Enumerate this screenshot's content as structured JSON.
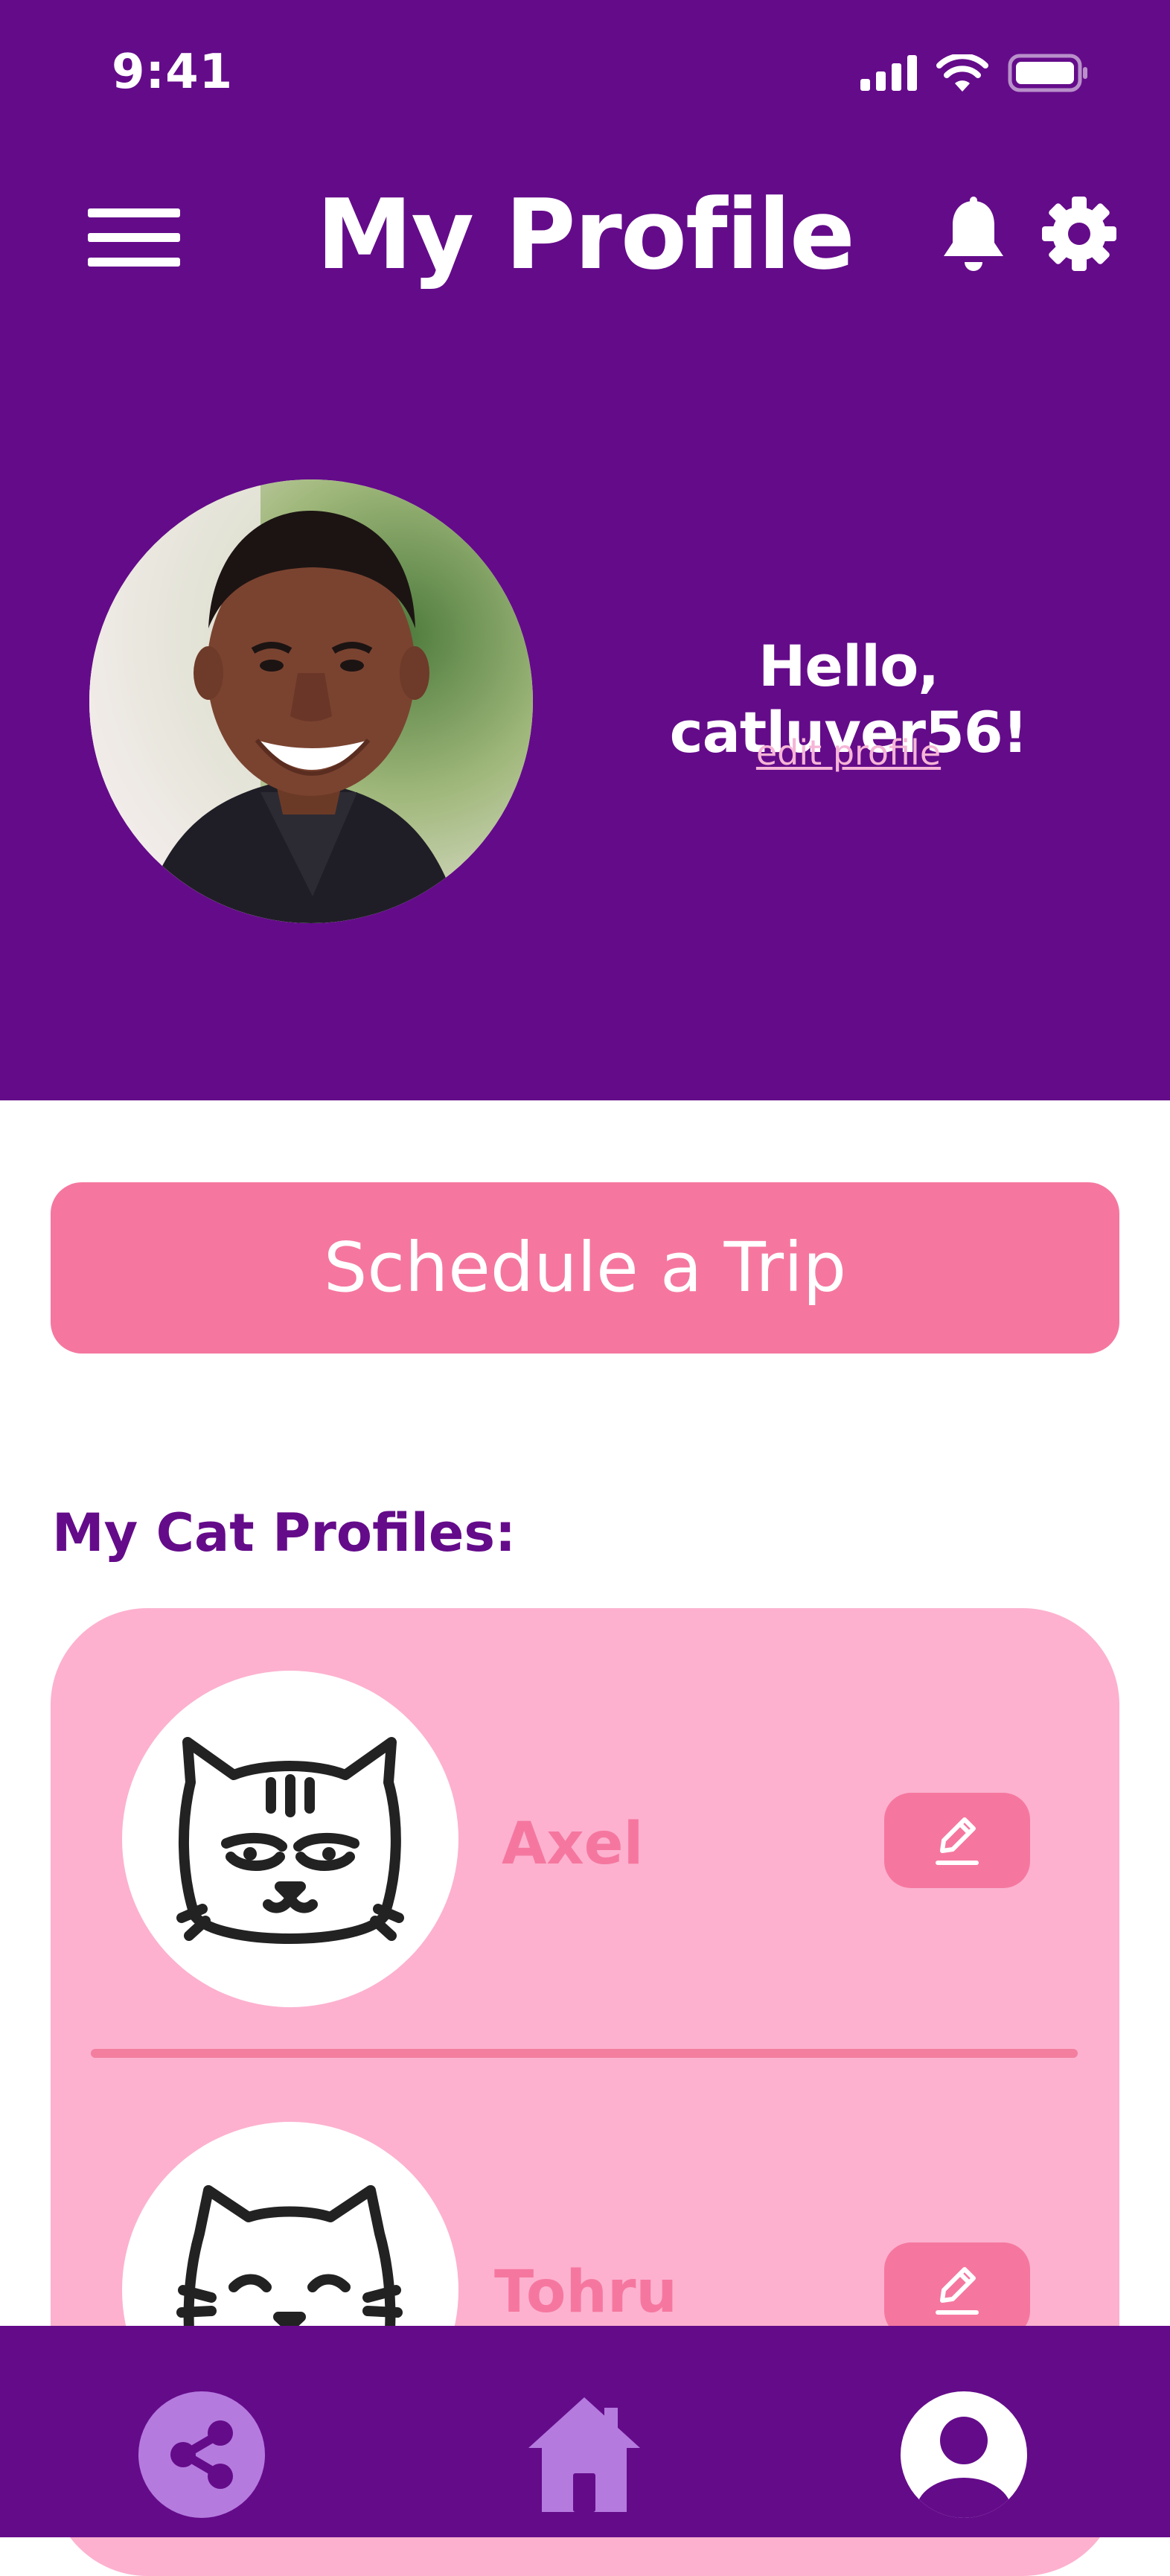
{
  "status_bar": {
    "time": "9:41"
  },
  "header": {
    "title": "My Profile",
    "greeting": "Hello, catluver56!",
    "edit_profile_label": "edit profile"
  },
  "schedule_button": {
    "label": "Schedule a Trip"
  },
  "cat_profiles": {
    "title": "My Cat Profiles:",
    "cats": [
      {
        "name": "Axel"
      },
      {
        "name": "Tohru"
      }
    ]
  },
  "icons": {
    "menu": "hamburger-menu-icon",
    "notifications": "bell-icon",
    "settings": "gear-icon",
    "share": "share-icon",
    "home": "home-icon",
    "profile": "user-profile-icon",
    "edit": "pencil-icon"
  },
  "colors": {
    "primary_purple": "#640B8A",
    "pink_button": "#F5779F",
    "card_pink": "#FDB1CF",
    "nav_icon_lavender": "#B57ADE"
  }
}
